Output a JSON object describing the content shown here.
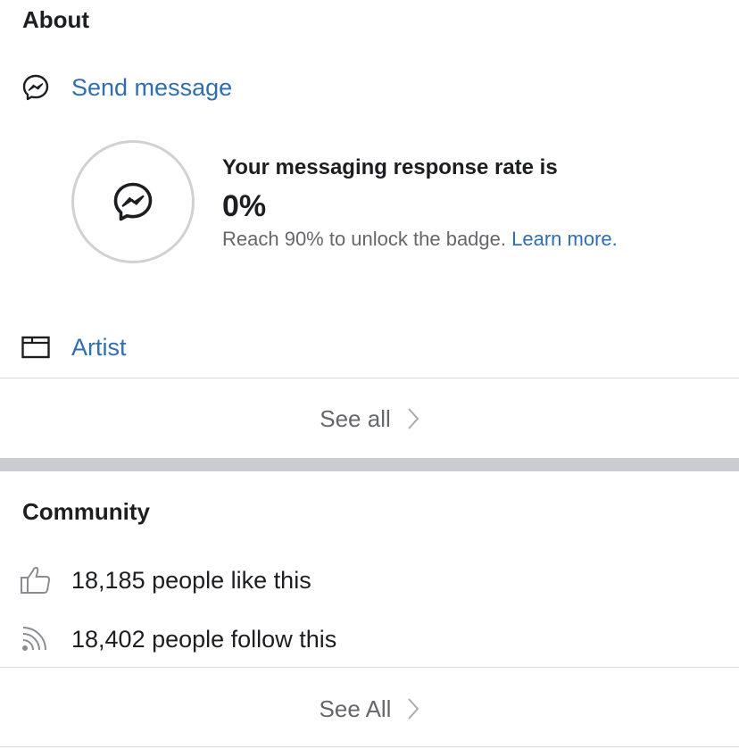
{
  "about": {
    "title": "About",
    "send_message": {
      "label": "Send message",
      "icon": "messenger-icon"
    },
    "response_rate": {
      "heading": "Your messaging response rate is",
      "value": "0%",
      "hint": "Reach 90% to unlock the badge.",
      "learn_more": "Learn more.",
      "icon": "messenger-icon"
    },
    "category": {
      "label": "Artist",
      "icon": "category-folder-icon"
    },
    "see_all": "See all"
  },
  "community": {
    "title": "Community",
    "likes": {
      "text": "18,185 people like this",
      "icon": "thumbs-up-icon"
    },
    "follows": {
      "text": "18,402 people follow this",
      "icon": "rss-icon"
    },
    "see_all": "See All"
  },
  "colors": {
    "link": "#2f6fb1",
    "text": "#1c1e21",
    "secondary_text": "#65676b",
    "divider": "#d6d8dc",
    "section_gutter": "#c9ccd1"
  }
}
